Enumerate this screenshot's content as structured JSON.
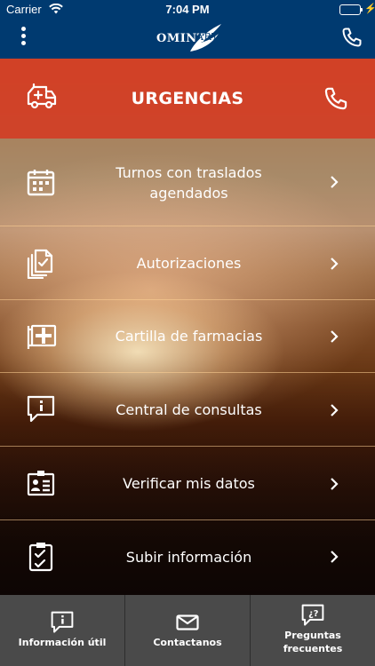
{
  "status_bar": {
    "carrier": "Carrier",
    "time": "7:04 PM",
    "battery_color": "#4cd964"
  },
  "header": {
    "logo_primary": "OMINT",
    "logo_secondary": "ART",
    "background_color": "#003a70",
    "menu_icon": "more-vertical-icon",
    "phone_icon": "phone-icon"
  },
  "urgent": {
    "label": "URGENCIAS",
    "icon": "ambulance-icon",
    "phone_icon": "phone-icon",
    "background_color": "#d23e26"
  },
  "menu": {
    "items": [
      {
        "label": "Turnos con traslados agendados",
        "icon": "calendar-icon"
      },
      {
        "label": "Autorizaciones",
        "icon": "documents-check-icon"
      },
      {
        "label": "Cartilla de farmacias",
        "icon": "pharmacy-icon"
      },
      {
        "label": "Central de consultas",
        "icon": "info-chat-icon"
      },
      {
        "label": "Verificar mis datos",
        "icon": "id-card-icon"
      },
      {
        "label": "Subir información",
        "icon": "checklist-icon"
      }
    ]
  },
  "tabbar": {
    "tabs": [
      {
        "label": "Información útil",
        "icon": "info-chat-icon"
      },
      {
        "label": "Contactanos",
        "icon": "mail-icon"
      },
      {
        "label": "Preguntas frecuentes",
        "icon": "question-chat-icon"
      }
    ]
  }
}
